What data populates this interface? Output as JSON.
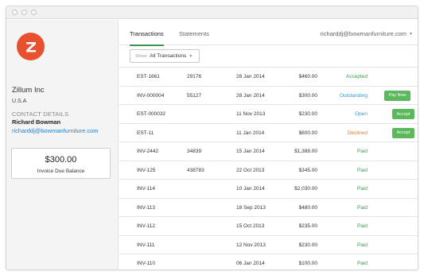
{
  "colors": {
    "brand": "#e8512f",
    "accent": "#3a9a4b",
    "status_accepted": "#3a9a4b",
    "status_outstanding": "#2e9bd6",
    "status_open": "#2e9bd6",
    "status_declined": "#e87722",
    "status_paid": "#3a9a4b",
    "button": "#5cb85c"
  },
  "sidebar": {
    "logo_letter": "Z",
    "company_name": "Zillum Inc",
    "country": "U.S.A",
    "contact_heading": "CONTACT DETAILS",
    "contact_name": "Richard Bowman",
    "contact_email": "richarddj@bowmanfurniture.com",
    "balance_amount": "$300.00",
    "balance_label": "Invoice Due Balance"
  },
  "header": {
    "tabs": [
      {
        "label": "Transactions"
      },
      {
        "label": "Statements"
      }
    ],
    "user_email": "richarddj@bowmanfurniture.com"
  },
  "filter": {
    "prefix": "Show:",
    "value": "All Transactions"
  },
  "transactions": [
    {
      "ref": "EST-1661",
      "po": "29176",
      "date": "28 Jan 2014",
      "amount": "$460.00",
      "status": "Accepted",
      "status_color": "#3a9a4b",
      "action": ""
    },
    {
      "ref": "INV-000004",
      "po": "55127",
      "date": "28 Jan 2014",
      "amount": "$300.00",
      "status": "Outstanding",
      "status_color": "#2e9bd6",
      "action": "Pay Now"
    },
    {
      "ref": "EST-000032",
      "po": "",
      "date": "11 Nov 2013",
      "amount": "$230.00",
      "status": "Open",
      "status_color": "#2e9bd6",
      "action": "Accept"
    },
    {
      "ref": "EST-11",
      "po": "",
      "date": "11 Jan 2014",
      "amount": "$600.00",
      "status": "Declined",
      "status_color": "#e87722",
      "action": "Accept"
    },
    {
      "ref": "INV-2442",
      "po": "34839",
      "date": "15 Jan 2014",
      "amount": "$1,388.00",
      "status": "Paid",
      "status_color": "#3a9a4b",
      "action": ""
    },
    {
      "ref": "INV-125",
      "po": "438783",
      "date": "22 Oct 2013",
      "amount": "$345.00",
      "status": "Paid",
      "status_color": "#3a9a4b",
      "action": ""
    },
    {
      "ref": "INV-114",
      "po": "",
      "date": "10 Jan 2014",
      "amount": "$2,030.00",
      "status": "Paid",
      "status_color": "#3a9a4b",
      "action": ""
    },
    {
      "ref": "INV-113",
      "po": "",
      "date": "18 Sep 2013",
      "amount": "$480.00",
      "status": "Paid",
      "status_color": "#3a9a4b",
      "action": ""
    },
    {
      "ref": "INV-112",
      "po": "",
      "date": "15 Oct 2013",
      "amount": "$235.00",
      "status": "Paid",
      "status_color": "#3a9a4b",
      "action": ""
    },
    {
      "ref": "INV-111",
      "po": "",
      "date": "12 Nov 2013",
      "amount": "$230.00",
      "status": "Paid",
      "status_color": "#3a9a4b",
      "action": ""
    },
    {
      "ref": "INV-110",
      "po": "",
      "date": "06 Jan 2014",
      "amount": "$100.00",
      "status": "Paid",
      "status_color": "#3a9a4b",
      "action": ""
    }
  ]
}
